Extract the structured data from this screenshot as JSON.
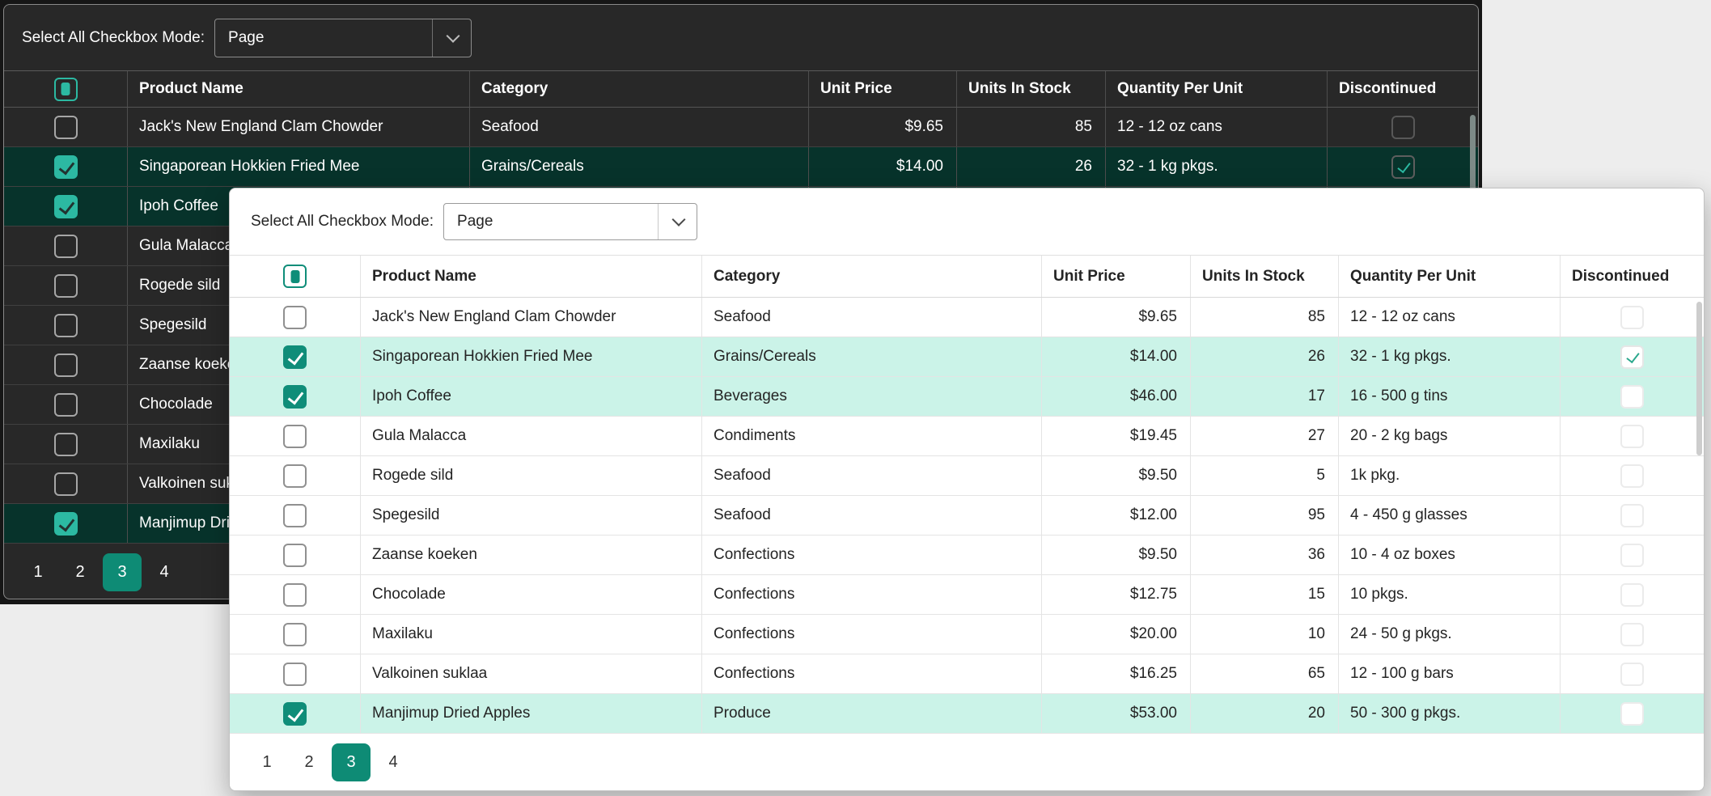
{
  "toolbar": {
    "label": "Select All Checkbox Mode:",
    "value": "Page",
    "options_visible": [
      "Page"
    ]
  },
  "columns": [
    "Product Name",
    "Category",
    "Unit Price",
    "Units In Stock",
    "Quantity Per Unit",
    "Discontinued"
  ],
  "rows": [
    {
      "name": "Jack's New England Clam Chowder",
      "category": "Seafood",
      "price": "$9.65",
      "stock": "85",
      "qty": "12 - 12 oz cans",
      "discontinued": false,
      "selected": false
    },
    {
      "name": "Singaporean Hokkien Fried Mee",
      "category": "Grains/Cereals",
      "price": "$14.00",
      "stock": "26",
      "qty": "32 - 1 kg pkgs.",
      "discontinued": true,
      "selected": true
    },
    {
      "name": "Ipoh Coffee",
      "category": "Beverages",
      "price": "$46.00",
      "stock": "17",
      "qty": "16 - 500 g tins",
      "discontinued": false,
      "selected": true
    },
    {
      "name": "Gula Malacca",
      "category": "Condiments",
      "price": "$19.45",
      "stock": "27",
      "qty": "20 - 2 kg bags",
      "discontinued": false,
      "selected": false
    },
    {
      "name": "Rogede sild",
      "category": "Seafood",
      "price": "$9.50",
      "stock": "5",
      "qty": "1k pkg.",
      "discontinued": false,
      "selected": false
    },
    {
      "name": "Spegesild",
      "category": "Seafood",
      "price": "$12.00",
      "stock": "95",
      "qty": "4 - 450 g glasses",
      "discontinued": false,
      "selected": false
    },
    {
      "name": "Zaanse koeken",
      "category": "Confections",
      "price": "$9.50",
      "stock": "36",
      "qty": "10 - 4 oz boxes",
      "discontinued": false,
      "selected": false
    },
    {
      "name": "Chocolade",
      "category": "Confections",
      "price": "$12.75",
      "stock": "15",
      "qty": "10 pkgs.",
      "discontinued": false,
      "selected": false
    },
    {
      "name": "Maxilaku",
      "category": "Confections",
      "price": "$20.00",
      "stock": "10",
      "qty": "24 - 50 g pkgs.",
      "discontinued": false,
      "selected": false
    },
    {
      "name": "Valkoinen suklaa",
      "category": "Confections",
      "price": "$16.25",
      "stock": "65",
      "qty": "12 - 100 g bars",
      "discontinued": false,
      "selected": false
    },
    {
      "name": "Manjimup Dried Apples",
      "category": "Produce",
      "price": "$53.00",
      "stock": "20",
      "qty": "50 - 300 g pkgs.",
      "discontinued": false,
      "selected": true
    }
  ],
  "pagination": {
    "pages": [
      "1",
      "2",
      "3",
      "4"
    ],
    "current": "3"
  },
  "icons": {
    "dropdown": "chevron-down",
    "checked": "checkmark",
    "select_all": "indeterminate-square"
  },
  "colors": {
    "accent_teal": "#0e8b75",
    "dark_accent_teal": "#2cb9a2",
    "dark_panel_bg": "#282828",
    "dark_selected_row": "#07332b",
    "light_selected_row": "#cbf3e8",
    "desktop_bg": "#ededed"
  }
}
